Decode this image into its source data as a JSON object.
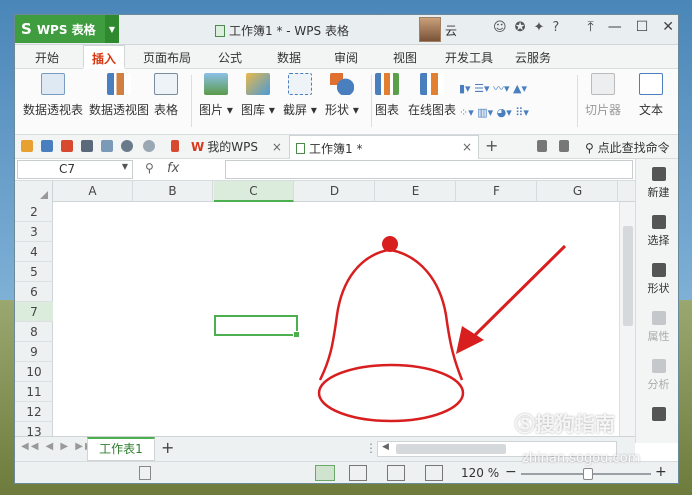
{
  "app": {
    "name": "WPS 表格",
    "window_title": "工作簿1 * - WPS 表格",
    "user": "云"
  },
  "menu": [
    "开始",
    "插入",
    "页面布局",
    "公式",
    "数据",
    "审阅",
    "视图",
    "开发工具",
    "云服务"
  ],
  "menu_active": "插入",
  "ribbon": {
    "pivot_table": "数据透视表",
    "pivot_chart": "数据透视图",
    "table": "表格",
    "picture": "图片",
    "gallery": "图库",
    "screenshot": "截屏",
    "shapes": "形状",
    "chart": "图表",
    "online_chart": "在线图表",
    "slicer": "切片器",
    "text": "文本"
  },
  "quickbar": {
    "my_wps": "我的WPS",
    "workbook_tab": "工作簿1 *",
    "find": "点此查找命令"
  },
  "formula_bar": {
    "name_box": "C7",
    "fx": "fx"
  },
  "columns": [
    "A",
    "B",
    "C",
    "D",
    "E",
    "F",
    "G"
  ],
  "active_column": "C",
  "rows": [
    "2",
    "3",
    "4",
    "5",
    "6",
    "7",
    "8",
    "9",
    "10",
    "11",
    "12",
    "13"
  ],
  "active_row": "7",
  "side_panel": {
    "new": "新建",
    "select": "选择",
    "shape": "形状",
    "properties": "属性",
    "analysis": "分析"
  },
  "sheet_tab": "工作表1",
  "status": {
    "zoom": "120 %"
  },
  "watermark": {
    "brand": "搜狗指南",
    "url": "zhinan.sogou.com"
  },
  "colors": {
    "accent": "#3f9c3f",
    "drawing": "#d81e1e",
    "active_menu": "#d6360f"
  }
}
